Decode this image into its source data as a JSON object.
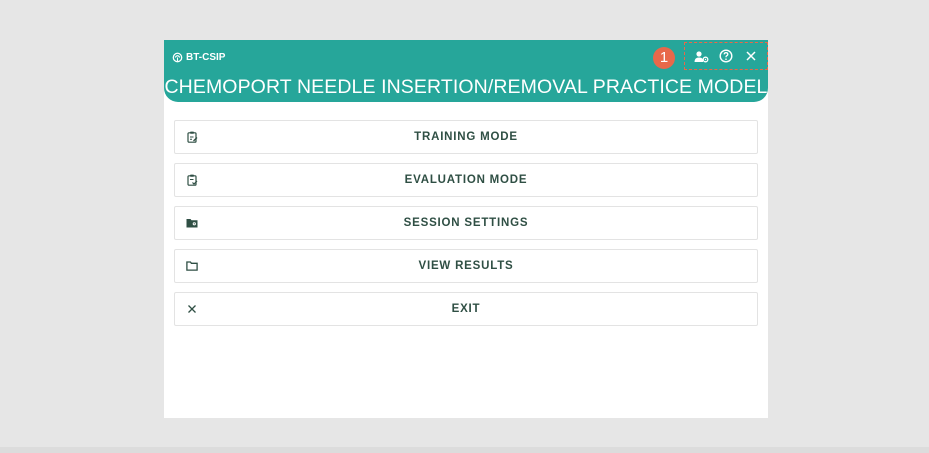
{
  "app": {
    "brand": "BT-CSIP",
    "title": "CHEMOPORT NEEDLE INSERTION/REMOVAL PRACTICE MODEL"
  },
  "header_actions": {
    "badge": "1",
    "icons": [
      "user-settings-icon",
      "help-icon",
      "close-icon"
    ]
  },
  "menu": {
    "items": [
      {
        "label": "TRAINING MODE",
        "icon": "clipboard-edit-icon"
      },
      {
        "label": "EVALUATION MODE",
        "icon": "clipboard-check-icon"
      },
      {
        "label": "SESSION SETTINGS",
        "icon": "folder-settings-icon"
      },
      {
        "label": "VIEW RESULTS",
        "icon": "folder-icon"
      },
      {
        "label": "EXIT",
        "icon": "close-icon"
      }
    ]
  },
  "colors": {
    "header": "#26a69a",
    "badge": "#e8684a",
    "menu_text": "#2f4f44"
  }
}
